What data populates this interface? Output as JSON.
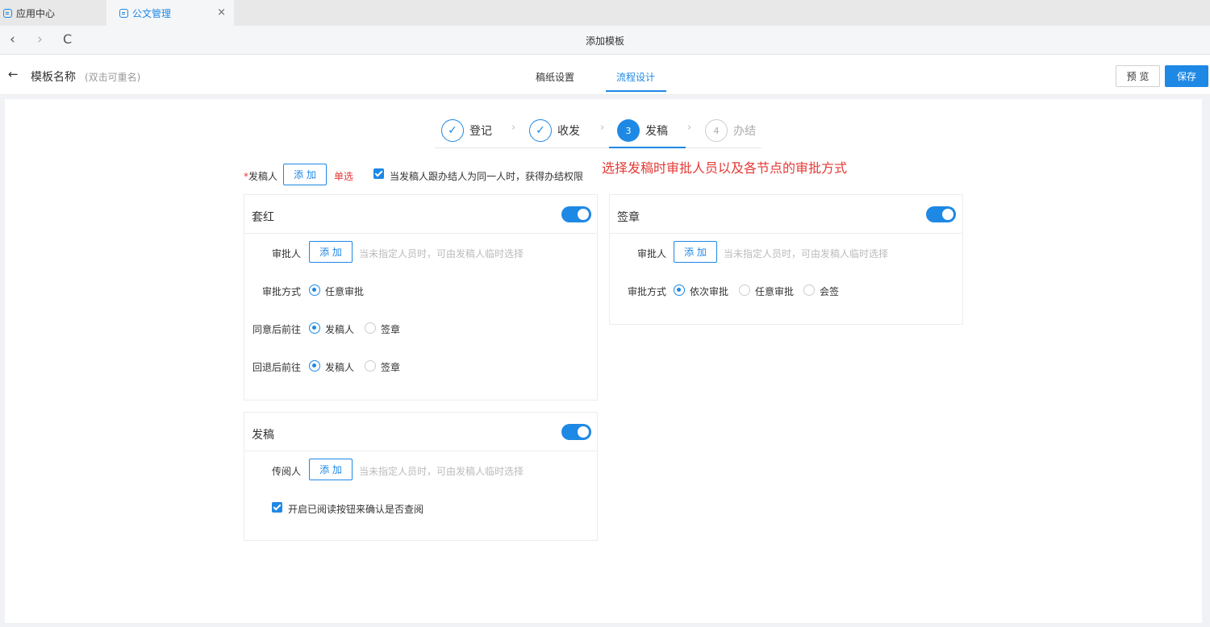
{
  "tabs": [
    {
      "label": "应用中心"
    },
    {
      "label": "公文管理"
    }
  ],
  "nav": {
    "title": "添加模板"
  },
  "header": {
    "template_name": "模板名称",
    "rename_hint": "(双击可重名)",
    "tabs": [
      {
        "label": "稿纸设置"
      },
      {
        "label": "流程设计"
      }
    ],
    "preview_label": "预 览",
    "save_label": "保存"
  },
  "steps": [
    {
      "number": "",
      "label": "登记",
      "state": "done"
    },
    {
      "number": "",
      "label": "收发",
      "state": "done"
    },
    {
      "number": "3",
      "label": "发稿",
      "state": "active"
    },
    {
      "number": "4",
      "label": "办结",
      "state": "todo"
    }
  ],
  "drafter": {
    "required_mark": "*",
    "label": "发稿人",
    "add_label": "添 加",
    "single_label": "单选",
    "checkbox_label": "当发稿人跟办结人为同一人时，获得办结权限"
  },
  "annotation": "选择发稿时审批人员以及各节点的审批方式",
  "cards": {
    "taohong": {
      "title": "套红",
      "approver_label": "审批人",
      "add_label": "添 加",
      "approver_hint": "当未指定人员时，可由发稿人临时选择",
      "method_label": "审批方式",
      "method_options": [
        "任意审批"
      ],
      "agree_label": "同意后前往",
      "agree_options": [
        "发稿人",
        "签章"
      ],
      "reject_label": "回退后前往",
      "reject_options": [
        "发稿人",
        "签章"
      ]
    },
    "qianzhang": {
      "title": "签章",
      "approver_label": "审批人",
      "add_label": "添 加",
      "approver_hint": "当未指定人员时，可由发稿人临时选择",
      "method_label": "审批方式",
      "method_options": [
        "依次审批",
        "任意审批",
        "会签"
      ]
    },
    "fagao": {
      "title": "发稿",
      "reader_label": "传阅人",
      "add_label": "添 加",
      "reader_hint": "当未指定人员时，可由发稿人临时选择",
      "checkbox_label": "开启已阅读按钮来确认是否查阅"
    }
  },
  "icons": {
    "back": "‹",
    "forward": "›",
    "reload": "C",
    "close": "×",
    "arrow_left": "←",
    "check": "✓",
    "step_sep": "›"
  }
}
